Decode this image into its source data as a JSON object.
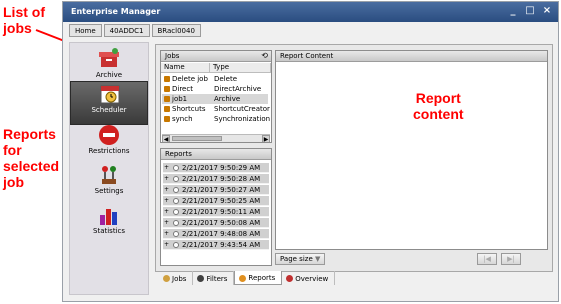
{
  "annotations": {
    "jobs_list": [
      "List of",
      "jobs"
    ],
    "reports": [
      "Reports",
      "for",
      "selected",
      "job"
    ],
    "content": [
      "Report",
      "content"
    ]
  },
  "window": {
    "title": "Enterprise Manager",
    "controls": [
      "_",
      "□",
      "×"
    ],
    "breadcrumbs": [
      "Home",
      "40ADDC1",
      "BRacl0040"
    ]
  },
  "nav": {
    "items": [
      {
        "label": "Archive",
        "icon": "archive-icon"
      },
      {
        "label": "Scheduler",
        "icon": "scheduler-icon",
        "active": true
      },
      {
        "label": "Restrictions",
        "icon": "restrictions-icon"
      },
      {
        "label": "Settings",
        "icon": "settings-icon"
      },
      {
        "label": "Statistics",
        "icon": "statistics-icon"
      }
    ]
  },
  "jobs": {
    "title": "Jobs",
    "columns": [
      "Name",
      "Type"
    ],
    "rows": [
      {
        "name": "Delete job",
        "type": "Delete"
      },
      {
        "name": "Direct",
        "type": "DirectArchive"
      },
      {
        "name": "job1",
        "type": "Archive",
        "selected": true
      },
      {
        "name": "Shortcuts",
        "type": "ShortcutCreator"
      },
      {
        "name": "synch",
        "type": "Synchronization"
      }
    ]
  },
  "reports": {
    "title": "Reports",
    "rows": [
      "2/21/2017 9:50:29 AM",
      "2/21/2017 9:50:28 AM",
      "2/21/2017 9:50:27 AM",
      "2/21/2017 9:50:25 AM",
      "2/21/2017 9:50:11 AM",
      "2/21/2017 9:50:08 AM",
      "2/21/2017 9:48:08 AM",
      "2/21/2017 9:43:54 AM"
    ]
  },
  "report_content": {
    "title": "Report Content",
    "page_size_label": "Page size"
  },
  "tabs": [
    {
      "label": "Jobs"
    },
    {
      "label": "Filters"
    },
    {
      "label": "Reports",
      "active": true
    },
    {
      "label": "Overview"
    }
  ]
}
